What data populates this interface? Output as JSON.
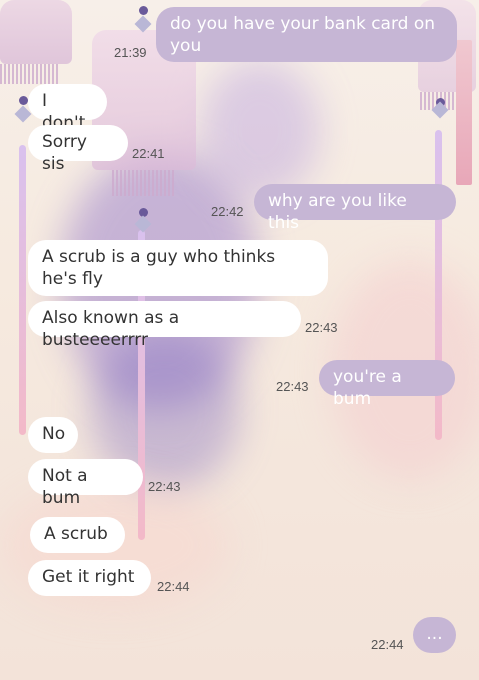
{
  "conversation": {
    "messages": [
      {
        "side": "out",
        "text": "do you have your bank card on you",
        "time": "21:39"
      },
      {
        "side": "in",
        "text": "I don't",
        "time": ""
      },
      {
        "side": "in",
        "text": "Sorry sis",
        "time": "22:41"
      },
      {
        "side": "out",
        "text": "why are you like this",
        "time": "22:42"
      },
      {
        "side": "in",
        "text": "A scrub is a guy who thinks he's fly",
        "time": ""
      },
      {
        "side": "in",
        "text": "Also known as a busteeeerrrr",
        "time": "22:43"
      },
      {
        "side": "out",
        "text": "you're a bum",
        "time": "22:43"
      },
      {
        "side": "in",
        "text": "No",
        "time": ""
      },
      {
        "side": "in",
        "text": "Not a bum",
        "time": "22:43"
      },
      {
        "side": "in",
        "text": "A scrub",
        "time": ""
      },
      {
        "side": "in",
        "text": "Get it right",
        "time": "22:44"
      },
      {
        "side": "out",
        "text": "...",
        "time": "22:44"
      }
    ]
  },
  "colors": {
    "incoming_bubble": "#ffffff",
    "outgoing_bubble": "#c6b6d5",
    "incoming_text": "#333333",
    "outgoing_text": "#ffffff"
  }
}
